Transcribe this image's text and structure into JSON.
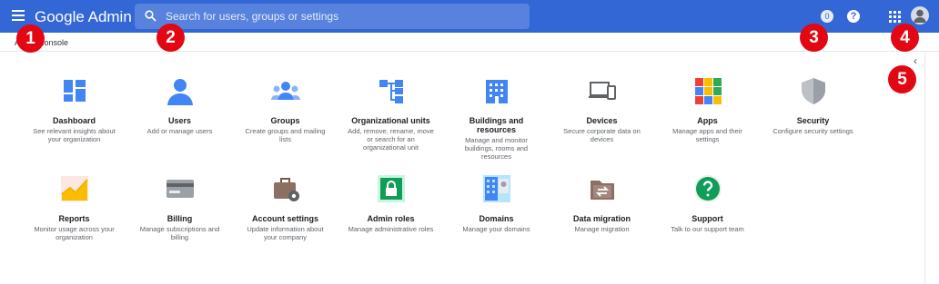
{
  "header": {
    "brand": "Google Admin",
    "search_placeholder": "Search for users, groups or settings",
    "notification_count": "0",
    "help_label": "?"
  },
  "breadcrumb": "Admin console",
  "markers": [
    "1",
    "2",
    "3",
    "4",
    "5"
  ],
  "collapse_label": "‹",
  "cards": [
    {
      "title": "Dashboard",
      "desc": "See relevant insights about your organization",
      "icon": "dashboard-icon"
    },
    {
      "title": "Users",
      "desc": "Add or manage users",
      "icon": "user-icon"
    },
    {
      "title": "Groups",
      "desc": "Create groups and mailing lists",
      "icon": "groups-icon"
    },
    {
      "title": "Organizational units",
      "desc": "Add, remove, rename, move or search for an organizational unit",
      "icon": "org-units-icon"
    },
    {
      "title": "Buildings and resources",
      "desc": "Manage and monitor buildings, rooms and resources",
      "icon": "building-icon"
    },
    {
      "title": "Devices",
      "desc": "Secure corporate data on devices",
      "icon": "devices-icon"
    },
    {
      "title": "Apps",
      "desc": "Manage apps and their settings",
      "icon": "apps-icon"
    },
    {
      "title": "Security",
      "desc": "Configure security settings",
      "icon": "shield-icon"
    },
    {
      "title": "Reports",
      "desc": "Monitor usage across your organization",
      "icon": "reports-icon"
    },
    {
      "title": "Billing",
      "desc": "Manage subscriptions and billing",
      "icon": "credit-card-icon"
    },
    {
      "title": "Account settings",
      "desc": "Update information about your company",
      "icon": "briefcase-gear-icon"
    },
    {
      "title": "Admin roles",
      "desc": "Manage administrative roles",
      "icon": "lock-icon"
    },
    {
      "title": "Domains",
      "desc": "Manage your domains",
      "icon": "domains-icon"
    },
    {
      "title": "Data migration",
      "desc": "Manage migration",
      "icon": "data-migration-icon"
    },
    {
      "title": "Support",
      "desc": "Talk to our support team",
      "icon": "help-circle-icon"
    }
  ]
}
